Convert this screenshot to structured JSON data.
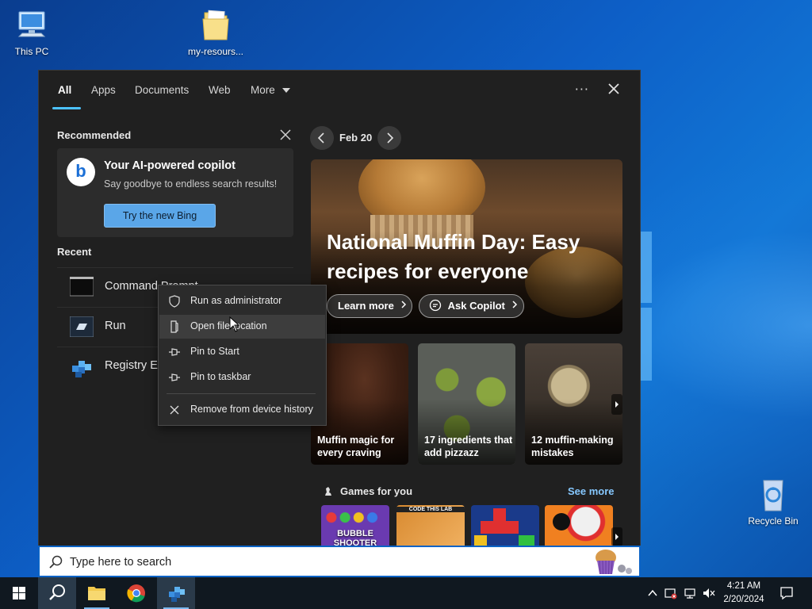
{
  "desktop": {
    "icons": [
      {
        "label": "This PC"
      },
      {
        "label": "my-resours..."
      },
      {
        "label": "Recycle Bin"
      }
    ]
  },
  "tabs": [
    {
      "label": "All",
      "active": true
    },
    {
      "label": "Apps"
    },
    {
      "label": "Documents"
    },
    {
      "label": "Web"
    },
    {
      "label": "More"
    }
  ],
  "top_actions": {
    "more_label": "···"
  },
  "recommended": {
    "title": "Recommended",
    "card": {
      "title": "Your AI-powered copilot",
      "subtitle": "Say goodbye to endless search results!",
      "button": "Try the new Bing",
      "logo_letter": "b"
    }
  },
  "recent": {
    "title": "Recent",
    "items": [
      {
        "label": "Command Prompt"
      },
      {
        "label": "Run"
      },
      {
        "label": "Registry Editor"
      }
    ]
  },
  "context_menu": {
    "items": [
      {
        "label": "Run as administrator",
        "icon": "shield-icon"
      },
      {
        "label": "Open file location",
        "icon": "folder-icon"
      },
      {
        "label": "Pin to Start",
        "icon": "pin-icon"
      },
      {
        "label": "Pin to taskbar",
        "icon": "pin-icon"
      },
      {
        "label": "Remove from device history",
        "icon": "close-icon"
      }
    ]
  },
  "feed": {
    "date": "Feb 20",
    "hero": {
      "title": "National Muffin Day: Easy recipes for everyone",
      "learn_more": "Learn more",
      "ask_copilot": "Ask Copilot"
    },
    "cards": [
      {
        "title": "Muffin magic for every craving"
      },
      {
        "title": "17 ingredients that add pizzazz"
      },
      {
        "title": "12 muffin-making mistakes"
      }
    ],
    "games": {
      "title": "Games for you",
      "see_more": "See more",
      "tiles": [
        {
          "label": "BUBBLE SHOOTER"
        },
        {
          "label": "CODE THIS LAB"
        },
        {
          "label": ""
        },
        {
          "label": ""
        }
      ]
    }
  },
  "search": {
    "placeholder": "Type here to search"
  },
  "taskbar": {
    "time": "4:21 AM",
    "date": "2/20/2024"
  },
  "colors": {
    "accent": "#4cc2ff",
    "panel_bg": "#202020",
    "link": "#86c8ff",
    "taskbar_bg": "#101820"
  }
}
